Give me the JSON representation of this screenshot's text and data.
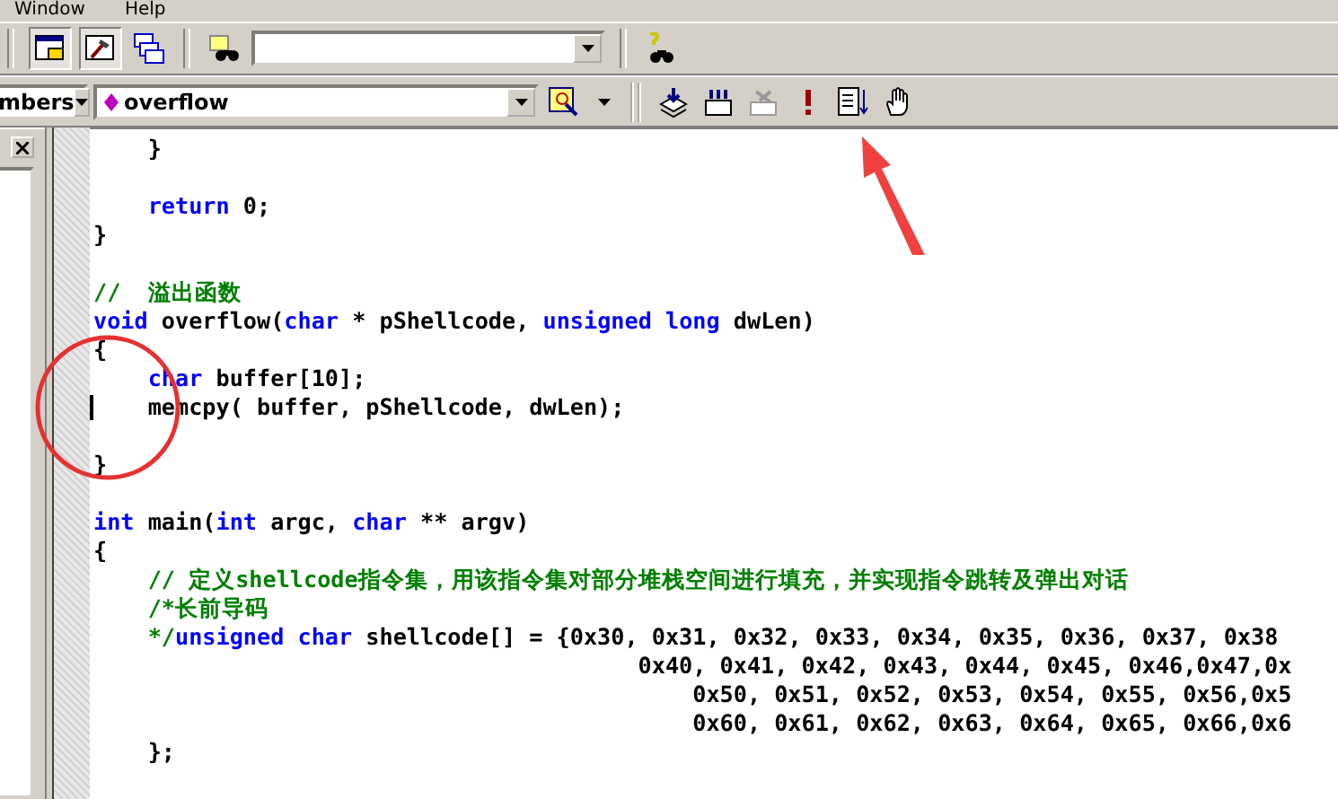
{
  "menu": [
    "Window",
    "Help"
  ],
  "toolbar2": {
    "class_combo": "mbers",
    "member_combo": "overflow"
  },
  "code": [
    {
      "kind": "code",
      "caret": false,
      "tokens": [
        {
          "kind": "plain",
          "text": "    }"
        }
      ]
    },
    {
      "kind": "blank",
      "caret": false
    },
    {
      "kind": "code",
      "caret": false,
      "tokens": [
        {
          "kind": "keyword",
          "text": "    return"
        },
        {
          "kind": "plain",
          "text": " 0;"
        }
      ]
    },
    {
      "kind": "code",
      "caret": false,
      "tokens": [
        {
          "kind": "plain",
          "text": "}"
        }
      ]
    },
    {
      "kind": "blank",
      "caret": false
    },
    {
      "kind": "code",
      "caret": false,
      "tokens": [
        {
          "kind": "comment",
          "text": "//  溢出函数"
        }
      ]
    },
    {
      "kind": "code",
      "caret": false,
      "tokens": [
        {
          "kind": "keyword",
          "text": "void"
        },
        {
          "kind": "plain",
          "text": " overflow("
        },
        {
          "kind": "keyword",
          "text": "char"
        },
        {
          "kind": "plain",
          "text": " * pShellcode, "
        },
        {
          "kind": "keyword",
          "text": "unsigned long"
        },
        {
          "kind": "plain",
          "text": " dwLen)"
        }
      ]
    },
    {
      "kind": "code",
      "caret": false,
      "tokens": [
        {
          "kind": "plain",
          "text": "{"
        }
      ]
    },
    {
      "kind": "code",
      "caret": false,
      "tokens": [
        {
          "kind": "keyword",
          "text": "    char"
        },
        {
          "kind": "plain",
          "text": " buffer[10];"
        }
      ]
    },
    {
      "kind": "code",
      "caret": true,
      "tokens": [
        {
          "kind": "plain",
          "text": "    memcpy( buffer, pShellcode, dwLen);"
        }
      ]
    },
    {
      "kind": "blank",
      "caret": false
    },
    {
      "kind": "code",
      "caret": false,
      "tokens": [
        {
          "kind": "plain",
          "text": "}"
        }
      ]
    },
    {
      "kind": "blank",
      "caret": false
    },
    {
      "kind": "code",
      "caret": false,
      "tokens": [
        {
          "kind": "keyword",
          "text": "int"
        },
        {
          "kind": "plain",
          "text": " main("
        },
        {
          "kind": "keyword",
          "text": "int"
        },
        {
          "kind": "plain",
          "text": " argc, "
        },
        {
          "kind": "keyword",
          "text": "char"
        },
        {
          "kind": "plain",
          "text": " ** argv)"
        }
      ]
    },
    {
      "kind": "code",
      "caret": false,
      "tokens": [
        {
          "kind": "plain",
          "text": "{"
        }
      ]
    },
    {
      "kind": "code",
      "caret": false,
      "tokens": [
        {
          "kind": "comment",
          "text": "    // 定义shellcode指令集，用该指令集对部分堆栈空间进行填充，并实现指令跳转及弹出对话"
        }
      ]
    },
    {
      "kind": "code",
      "caret": false,
      "tokens": [
        {
          "kind": "comment",
          "text": "    /*长前导码"
        }
      ]
    },
    {
      "kind": "code",
      "caret": false,
      "tokens": [
        {
          "kind": "comment",
          "text": "    */"
        },
        {
          "kind": "keyword",
          "text": "unsigned char"
        },
        {
          "kind": "plain",
          "text": " shellcode[] = {0x30, 0x31, 0x32, 0x33, 0x34, 0x35, 0x36, 0x37, 0x38"
        }
      ]
    },
    {
      "kind": "code",
      "caret": false,
      "tokens": [
        {
          "kind": "plain",
          "text": "                                        0x40, 0x41, 0x42, 0x43, 0x44, 0x45, 0x46,0x47,0x"
        }
      ]
    },
    {
      "kind": "code",
      "caret": false,
      "tokens": [
        {
          "kind": "plain",
          "text": "                                            0x50, 0x51, 0x52, 0x53, 0x54, 0x55, 0x56,0x5"
        }
      ]
    },
    {
      "kind": "code",
      "caret": false,
      "tokens": [
        {
          "kind": "plain",
          "text": "                                            0x60, 0x61, 0x62, 0x63, 0x64, 0x65, 0x66,0x6"
        }
      ]
    },
    {
      "kind": "code",
      "caret": false,
      "tokens": [
        {
          "kind": "plain",
          "text": "    };"
        }
      ]
    }
  ]
}
